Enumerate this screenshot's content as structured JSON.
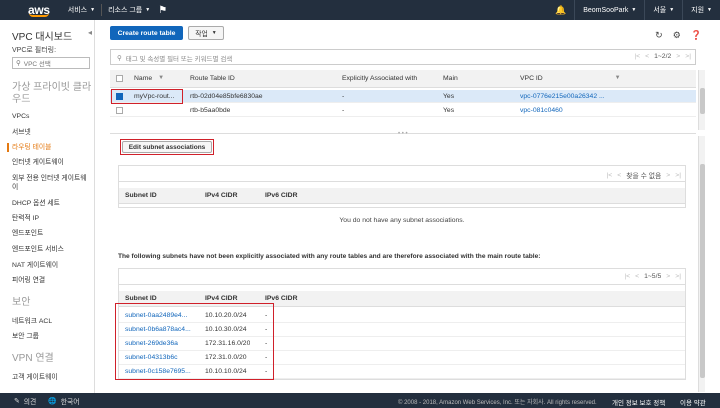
{
  "topnav": {
    "logo": "aws",
    "services": "서비스",
    "resource_groups": "리소스 그룹",
    "user": "BeomSooPark",
    "region": "서울",
    "support": "지원"
  },
  "sidebar": {
    "title": "VPC 대시보드",
    "filter_label": "VPC로 필터링:",
    "filter_placeholder": "VPC 선택",
    "sections": [
      {
        "label": "가상 프라이빗 클라우드"
      },
      {
        "label": "보안"
      },
      {
        "label": "VPN 연결"
      }
    ],
    "items_vpc": [
      "VPCs",
      "서브넷",
      "라우팅 테이블",
      "인터넷 게이트웨이",
      "외부 전용 인터넷 게이트웨이",
      "DHCP 옵션 세트",
      "탄력적 IP",
      "엔드포인트",
      "엔드포인트 서비스",
      "NAT 게이트웨이",
      "피어링 연결"
    ],
    "items_security": [
      "네트워크 ACL",
      "보안 그룹"
    ],
    "items_vpn": [
      "고객 게이트웨이"
    ]
  },
  "toolbar": {
    "create_label": "Create route table",
    "actions_label": "작업"
  },
  "search": {
    "placeholder": "태그 및 속성별 필터 또는 키워드별 검색",
    "pager": "1~2/2"
  },
  "route_table": {
    "columns": [
      "Name",
      "Route Table ID",
      "Explicitly Associated with",
      "Main",
      "VPC ID"
    ],
    "rows": [
      {
        "name": "myVpc-rout...",
        "id": "rtb-02d04e85bfe6830ae",
        "assoc": "-",
        "main": "Yes",
        "vpc": "vpc-0776e215e00a26342 ...",
        "selected": true
      },
      {
        "name": "",
        "id": "rtb-b5aa0bde",
        "assoc": "-",
        "main": "Yes",
        "vpc": "vpc-081c0460",
        "selected": false
      }
    ]
  },
  "details": {
    "edit_label": "Edit subnet associations",
    "assoc_pager": "찾을 수 없음",
    "assoc_columns": [
      "Subnet ID",
      "IPv4 CIDR",
      "IPv6 CIDR"
    ],
    "empty_message": "You do not have any subnet associations.",
    "notice": "The following subnets have not been explicitly associated with any route tables and are therefore associated with the main route table:",
    "unassoc_pager": "1~5/5",
    "unassoc_columns": [
      "Subnet ID",
      "IPv4 CIDR",
      "IPv6 CIDR"
    ],
    "unassoc_rows": [
      {
        "id": "subnet-0aa2489e4...",
        "v4": "10.10.20.0/24",
        "v6": "-"
      },
      {
        "id": "subnet-0b6a878ac4...",
        "v4": "10.10.30.0/24",
        "v6": "-"
      },
      {
        "id": "subnet-269de36a",
        "v4": "172.31.16.0/20",
        "v6": "-"
      },
      {
        "id": "subnet-04313b6c",
        "v4": "172.31.0.0/20",
        "v6": "-"
      },
      {
        "id": "subnet-0c158e7695...",
        "v4": "10.10.10.0/24",
        "v6": "-"
      }
    ]
  },
  "footer": {
    "feedback": "의견",
    "language": "한국어",
    "copyright": "© 2008 - 2018, Amazon Web Services, Inc. 또는 자회사. All rights reserved.",
    "privacy": "개인 정보 보호 정책",
    "terms": "이용 약관"
  }
}
